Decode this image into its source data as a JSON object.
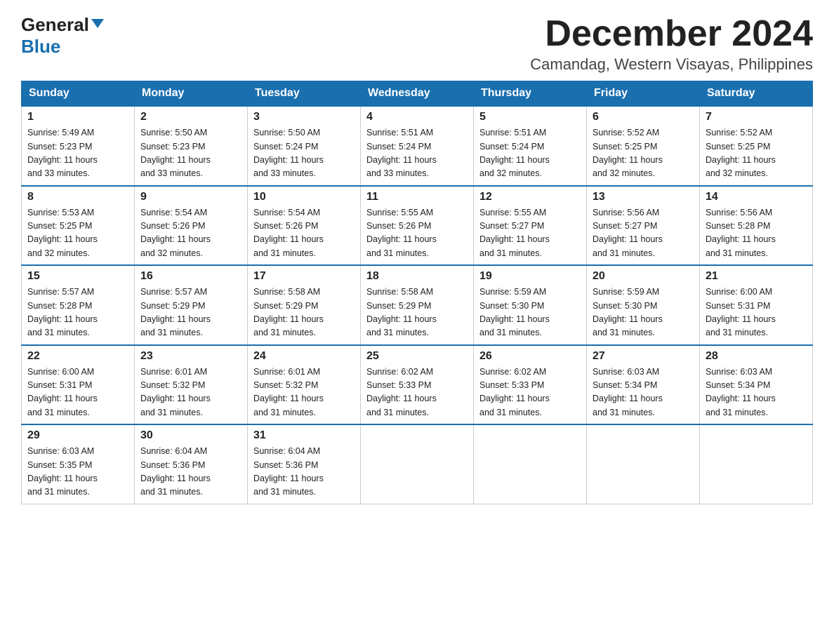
{
  "logo": {
    "general": "General",
    "blue": "Blue"
  },
  "title": "December 2024",
  "location": "Camandag, Western Visayas, Philippines",
  "weekdays": [
    "Sunday",
    "Monday",
    "Tuesday",
    "Wednesday",
    "Thursday",
    "Friday",
    "Saturday"
  ],
  "weeks": [
    [
      {
        "day": "1",
        "sunrise": "5:49 AM",
        "sunset": "5:23 PM",
        "daylight": "11 hours and 33 minutes."
      },
      {
        "day": "2",
        "sunrise": "5:50 AM",
        "sunset": "5:23 PM",
        "daylight": "11 hours and 33 minutes."
      },
      {
        "day": "3",
        "sunrise": "5:50 AM",
        "sunset": "5:24 PM",
        "daylight": "11 hours and 33 minutes."
      },
      {
        "day": "4",
        "sunrise": "5:51 AM",
        "sunset": "5:24 PM",
        "daylight": "11 hours and 33 minutes."
      },
      {
        "day": "5",
        "sunrise": "5:51 AM",
        "sunset": "5:24 PM",
        "daylight": "11 hours and 32 minutes."
      },
      {
        "day": "6",
        "sunrise": "5:52 AM",
        "sunset": "5:25 PM",
        "daylight": "11 hours and 32 minutes."
      },
      {
        "day": "7",
        "sunrise": "5:52 AM",
        "sunset": "5:25 PM",
        "daylight": "11 hours and 32 minutes."
      }
    ],
    [
      {
        "day": "8",
        "sunrise": "5:53 AM",
        "sunset": "5:25 PM",
        "daylight": "11 hours and 32 minutes."
      },
      {
        "day": "9",
        "sunrise": "5:54 AM",
        "sunset": "5:26 PM",
        "daylight": "11 hours and 32 minutes."
      },
      {
        "day": "10",
        "sunrise": "5:54 AM",
        "sunset": "5:26 PM",
        "daylight": "11 hours and 31 minutes."
      },
      {
        "day": "11",
        "sunrise": "5:55 AM",
        "sunset": "5:26 PM",
        "daylight": "11 hours and 31 minutes."
      },
      {
        "day": "12",
        "sunrise": "5:55 AM",
        "sunset": "5:27 PM",
        "daylight": "11 hours and 31 minutes."
      },
      {
        "day": "13",
        "sunrise": "5:56 AM",
        "sunset": "5:27 PM",
        "daylight": "11 hours and 31 minutes."
      },
      {
        "day": "14",
        "sunrise": "5:56 AM",
        "sunset": "5:28 PM",
        "daylight": "11 hours and 31 minutes."
      }
    ],
    [
      {
        "day": "15",
        "sunrise": "5:57 AM",
        "sunset": "5:28 PM",
        "daylight": "11 hours and 31 minutes."
      },
      {
        "day": "16",
        "sunrise": "5:57 AM",
        "sunset": "5:29 PM",
        "daylight": "11 hours and 31 minutes."
      },
      {
        "day": "17",
        "sunrise": "5:58 AM",
        "sunset": "5:29 PM",
        "daylight": "11 hours and 31 minutes."
      },
      {
        "day": "18",
        "sunrise": "5:58 AM",
        "sunset": "5:29 PM",
        "daylight": "11 hours and 31 minutes."
      },
      {
        "day": "19",
        "sunrise": "5:59 AM",
        "sunset": "5:30 PM",
        "daylight": "11 hours and 31 minutes."
      },
      {
        "day": "20",
        "sunrise": "5:59 AM",
        "sunset": "5:30 PM",
        "daylight": "11 hours and 31 minutes."
      },
      {
        "day": "21",
        "sunrise": "6:00 AM",
        "sunset": "5:31 PM",
        "daylight": "11 hours and 31 minutes."
      }
    ],
    [
      {
        "day": "22",
        "sunrise": "6:00 AM",
        "sunset": "5:31 PM",
        "daylight": "11 hours and 31 minutes."
      },
      {
        "day": "23",
        "sunrise": "6:01 AM",
        "sunset": "5:32 PM",
        "daylight": "11 hours and 31 minutes."
      },
      {
        "day": "24",
        "sunrise": "6:01 AM",
        "sunset": "5:32 PM",
        "daylight": "11 hours and 31 minutes."
      },
      {
        "day": "25",
        "sunrise": "6:02 AM",
        "sunset": "5:33 PM",
        "daylight": "11 hours and 31 minutes."
      },
      {
        "day": "26",
        "sunrise": "6:02 AM",
        "sunset": "5:33 PM",
        "daylight": "11 hours and 31 minutes."
      },
      {
        "day": "27",
        "sunrise": "6:03 AM",
        "sunset": "5:34 PM",
        "daylight": "11 hours and 31 minutes."
      },
      {
        "day": "28",
        "sunrise": "6:03 AM",
        "sunset": "5:34 PM",
        "daylight": "11 hours and 31 minutes."
      }
    ],
    [
      {
        "day": "29",
        "sunrise": "6:03 AM",
        "sunset": "5:35 PM",
        "daylight": "11 hours and 31 minutes."
      },
      {
        "day": "30",
        "sunrise": "6:04 AM",
        "sunset": "5:36 PM",
        "daylight": "11 hours and 31 minutes."
      },
      {
        "day": "31",
        "sunrise": "6:04 AM",
        "sunset": "5:36 PM",
        "daylight": "11 hours and 31 minutes."
      },
      null,
      null,
      null,
      null
    ]
  ],
  "labels": {
    "sunrise": "Sunrise:",
    "sunset": "Sunset:",
    "daylight": "Daylight:"
  },
  "colors": {
    "header_bg": "#1a6faf",
    "header_text": "#ffffff",
    "border": "#1a6faf",
    "cell_border": "#cccccc"
  }
}
